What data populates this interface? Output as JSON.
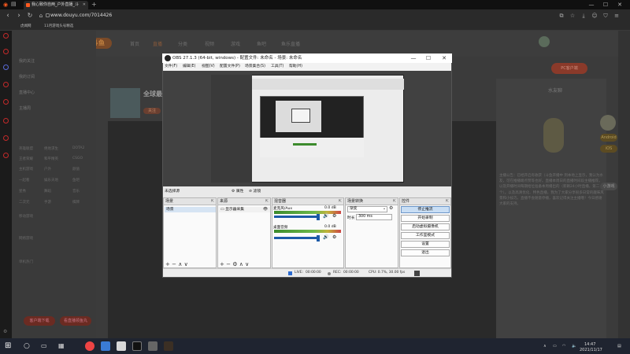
{
  "browser": {
    "tab_title": "我心致你自两_户外直播_斗",
    "url": "www.douyu.com/7014426",
    "bookmarks": [
      "虎闻网",
      "11月游戏头号精选"
    ]
  },
  "douyu": {
    "logo": "斗鱼",
    "nav": [
      "首页",
      "直播",
      "分类",
      "视频",
      "游戏",
      "鱼吧",
      "鱼乐直播"
    ],
    "sidebar": [
      "我的关注",
      "我的订阅",
      "直播中心",
      "主播周"
    ],
    "sidebar_grid": [
      [
        "英雄联盟",
        "绝地求生",
        "DOTA2"
      ],
      [
        "王者荣耀",
        "和平精英",
        "CSGO"
      ],
      [
        "主机游戏",
        "户外",
        "颜值"
      ],
      [
        "一起看",
        "娱乐天地",
        "鱼吧"
      ],
      [
        "星秀",
        "舞蹈",
        "音乐"
      ],
      [
        "二次元",
        "手游",
        "棋牌"
      ]
    ],
    "sidebar_section_2": [
      "移动游戏",
      "网络游戏",
      "单机热门"
    ],
    "sidebar_buttons": [
      "客户端下载",
      "看直播领鱼丸"
    ],
    "room_title": "全球最",
    "follow_btn": "关注",
    "badge": "PC客户端",
    "right_title": "水友聊",
    "right_text": "主播公告：已经开启有收获（斗鱼开播中 到本地上显示，我认为水友，可在推播端点赞等也好。直播本周日的直播时间段主播推荐，以及开播时间每期给位准备本周播出的（新颖24小时直播，第二个）。以及高清优化、特色直播，我为了大家分享很多日常的趣味风景和小技巧，直播不会随意停播，喜欢记得关注主播哦！今日感谢大家的支持。",
    "right_badges": [
      "Android",
      "iOS"
    ],
    "mini_game": "小游戏"
  },
  "obs": {
    "title": "OBS 27.1.3 (64-bit, windows) - 配置文件: 未命名 - 场景: 未命名",
    "menu": [
      "文件(F)",
      "编辑(E)",
      "视图(V)",
      "配置文件(P)",
      "场景集合(S)",
      "工具(T)",
      "帮助(H)"
    ],
    "preview_status": "未选择源",
    "preview_actions": [
      "属性",
      "滤镜"
    ],
    "docks": {
      "scenes": {
        "title": "场景",
        "items": [
          "场景"
        ]
      },
      "sources": {
        "title": "来源",
        "items": [
          "显示器采集"
        ]
      },
      "mixer": {
        "title": "混音器",
        "tracks": [
          {
            "name": "麦克风/Aux",
            "db": "0.0 dB"
          },
          {
            "name": "桌面音频",
            "db": "0.0 dB"
          }
        ]
      },
      "transitions": {
        "title": "场景转换",
        "type": "渐变",
        "duration_label": "时长",
        "duration": "300 ms"
      },
      "controls": {
        "title": "控件",
        "buttons": [
          "停止推流",
          "开始录制",
          "启动虚拟摄像机",
          "工作室模式",
          "设置",
          "退出"
        ]
      }
    },
    "status": {
      "live": "LIVE:",
      "live_time": "00:00:00",
      "rec": "REC:",
      "rec_time": "00:00:00",
      "cpu": "CPU: 0.7%, 30.00 fps"
    }
  },
  "taskbar": {
    "time": "14:47",
    "date": "2021/11/17"
  },
  "colors": {
    "accent": "#ff5a1f",
    "obs_primary": "#c9def4",
    "meter_green": "#3c8b2d"
  }
}
